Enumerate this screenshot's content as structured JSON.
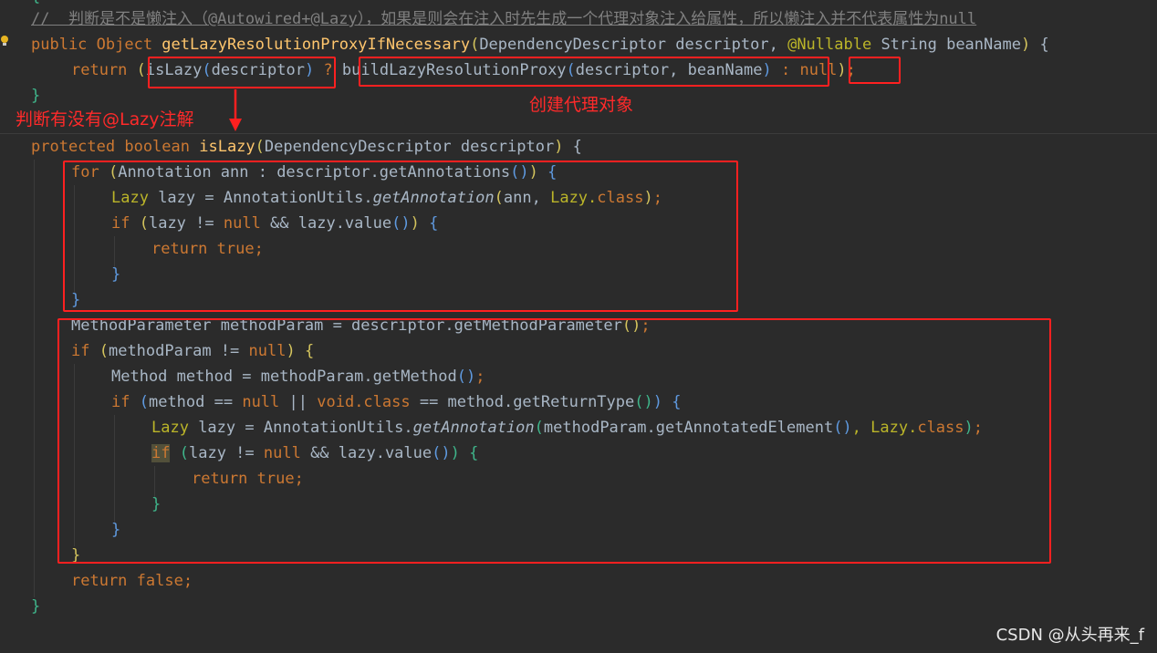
{
  "comment": "//  判断是不是懒注入（@Autowired+@Lazy），如果是则会在注入时先生成一个代理对象注入给属性，所以懒注入并不代表属性为null",
  "method1": {
    "mods": "public Object ",
    "name": "getLazyResolutionProxyIfNecessary",
    "params_a": "DependencyDescriptor descriptor, ",
    "annotation": "@Nullable",
    "params_b": " String beanName",
    "brace": " {",
    "ret_kw": "return ",
    "islazy_call": "isLazy",
    "descriptor": "descriptor",
    "ternary_q": " ? ",
    "build_call": "buildLazyResolutionProxy",
    "build_args": "descriptor, beanName",
    "ternary_colon": " : ",
    "null_kw": "null",
    "end": ");",
    "close": "}"
  },
  "method2": {
    "mods": "protected boolean ",
    "name": "isLazy",
    "params": "DependencyDescriptor descriptor",
    "brace": " {",
    "l1_for": "for ",
    "l1_rest": "Annotation ann : descriptor.getAnnotations",
    "l2_type": "Lazy",
    "l2_a": " lazy = AnnotationUtils.",
    "l2_fn": "getAnnotation",
    "l2_b": "ann, ",
    "l2_c": "Lazy.",
    "l2_cls": "class",
    "l3_if": "if ",
    "l3_a": "lazy != ",
    "l3_null": "null",
    "l3_b": " && lazy.value",
    "l4_ret": "return true;",
    "l7": "MethodParameter methodParam = descriptor.getMethodParameter",
    "l8_if": "if ",
    "l8_a": "methodParam != ",
    "l8_null": "null",
    "l9": "Method method = methodParam.getMethod",
    "l10_if": "if ",
    "l10_a": "method == ",
    "l10_null": "null",
    "l10_or": " || ",
    "l10_void": "void",
    "l10_cls": ".class",
    "l10_b": " == method.getReturnType",
    "l11_type": "Lazy",
    "l11_a": " lazy = AnnotationUtils.",
    "l11_fn": "getAnnotation",
    "l11_b": "methodParam.getAnnotatedElement",
    "l11_c": ", Lazy.",
    "l11_cls": "class",
    "l12_if": "if",
    "l12_a": "lazy != ",
    "l12_null": "null",
    "l12_b": " && lazy.value",
    "l13_ret": "return true;",
    "l17_ret": "return false;",
    "close": "}"
  },
  "annotations": {
    "note_lazy_check": "判断有没有@Lazy注解",
    "note_create_proxy": "创建代理对象"
  },
  "watermark": "CSDN @从头再来_f"
}
